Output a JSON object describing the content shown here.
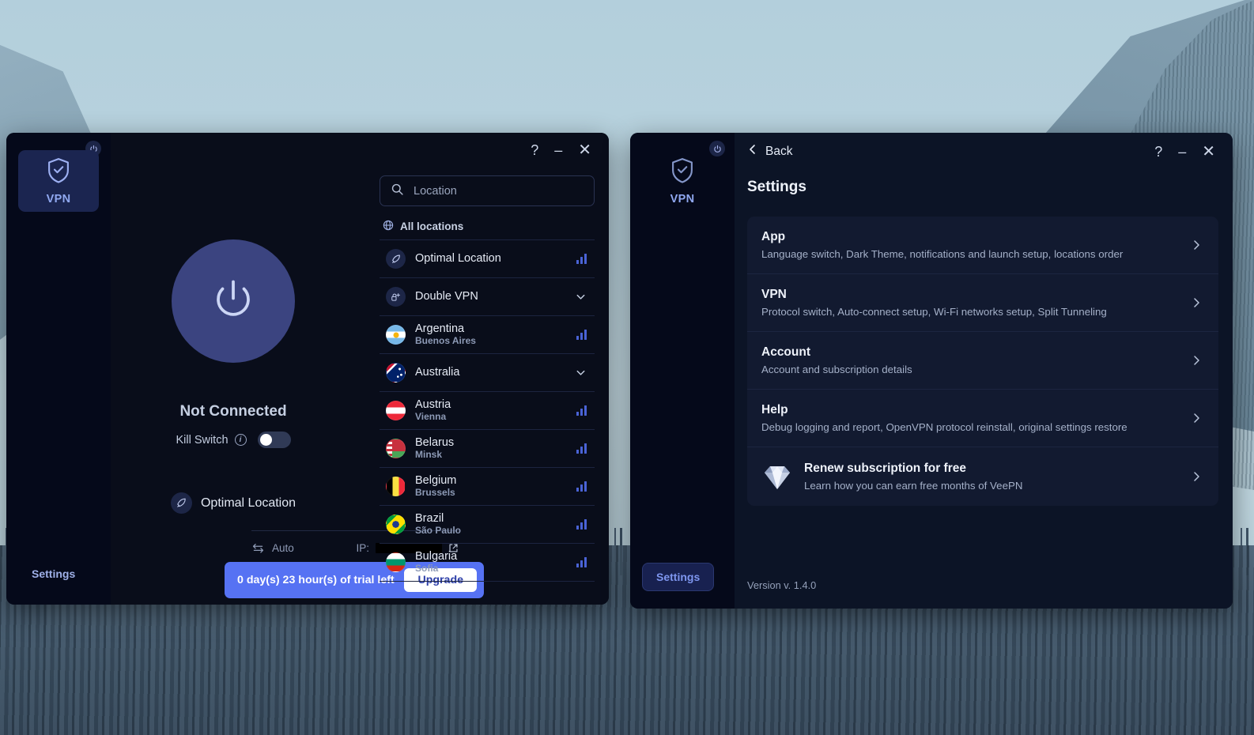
{
  "app": {
    "name": "VeePN",
    "version_label": "Version v. 1.4.0"
  },
  "window_main": {
    "rail": {
      "power_icon": "power-icon",
      "tile_label": "VPN",
      "tile_icon": "shield-check-icon",
      "settings_label": "Settings"
    },
    "titlebar": {
      "help": "?",
      "minimize": "–",
      "close": "✕"
    },
    "connection": {
      "power_button_icon": "power-icon",
      "status": "Not Connected",
      "kill_switch_label": "Kill Switch",
      "kill_switch_info_icon": "info-icon",
      "kill_switch_on": false,
      "selected_location": "Optimal Location",
      "selected_location_icon": "rocket-icon",
      "protocol_icon": "swap-arrows-icon",
      "protocol_value": "Auto",
      "ip_label": "IP:",
      "ip_value": "",
      "ip_external_icon": "external-link-icon"
    },
    "trial": {
      "message": "0 day(s) 23 hour(s) of trial left",
      "upgrade_label": "Upgrade",
      "accent": "#5672f3"
    },
    "locations": {
      "search_placeholder": "Location",
      "search_value": "",
      "search_icon": "search-icon",
      "section_icon": "globe-icon",
      "section_label": "All locations",
      "items": [
        {
          "name": "Optimal Location",
          "city": "",
          "kind": "rocket",
          "right": "bars"
        },
        {
          "name": "Double VPN",
          "city": "",
          "kind": "double-vpn",
          "right": "chevron"
        },
        {
          "name": "Argentina",
          "city": "Buenos Aires",
          "kind": "flag",
          "flag": "argentina",
          "right": "bars"
        },
        {
          "name": "Australia",
          "city": "",
          "kind": "flag",
          "flag": "australia",
          "right": "chevron"
        },
        {
          "name": "Austria",
          "city": "Vienna",
          "kind": "flag",
          "flag": "austria",
          "right": "bars"
        },
        {
          "name": "Belarus",
          "city": "Minsk",
          "kind": "flag",
          "flag": "belarus",
          "right": "bars"
        },
        {
          "name": "Belgium",
          "city": "Brussels",
          "kind": "flag",
          "flag": "belgium",
          "right": "bars"
        },
        {
          "name": "Brazil",
          "city": "São Paulo",
          "kind": "flag",
          "flag": "brazil",
          "right": "bars"
        },
        {
          "name": "Bulgaria",
          "city": "Sofia",
          "kind": "flag",
          "flag": "bulgaria",
          "right": "bars"
        }
      ]
    }
  },
  "window_settings": {
    "rail": {
      "power_icon": "power-icon",
      "tile_label": "VPN",
      "tile_icon": "shield-check-icon",
      "settings_label": "Settings"
    },
    "titlebar": {
      "help": "?",
      "minimize": "–",
      "close": "✕"
    },
    "back_label": "Back",
    "back_icon": "chevron-left-icon",
    "title": "Settings",
    "rows": [
      {
        "title": "App",
        "subtitle": "Language switch, Dark Theme, notifications and launch setup, locations order",
        "icon": ""
      },
      {
        "title": "VPN",
        "subtitle": "Protocol switch, Auto-connect setup, Wi-Fi networks setup, Split Tunneling",
        "icon": ""
      },
      {
        "title": "Account",
        "subtitle": "Account and subscription details",
        "icon": ""
      },
      {
        "title": "Help",
        "subtitle": "Debug logging and report, OpenVPN protocol reinstall, original settings restore",
        "icon": ""
      },
      {
        "title": "Renew subscription for free",
        "subtitle": "Learn how you can earn free months of VeePN",
        "icon": "diamond-icon"
      }
    ],
    "version": "Version v. 1.4.0"
  }
}
